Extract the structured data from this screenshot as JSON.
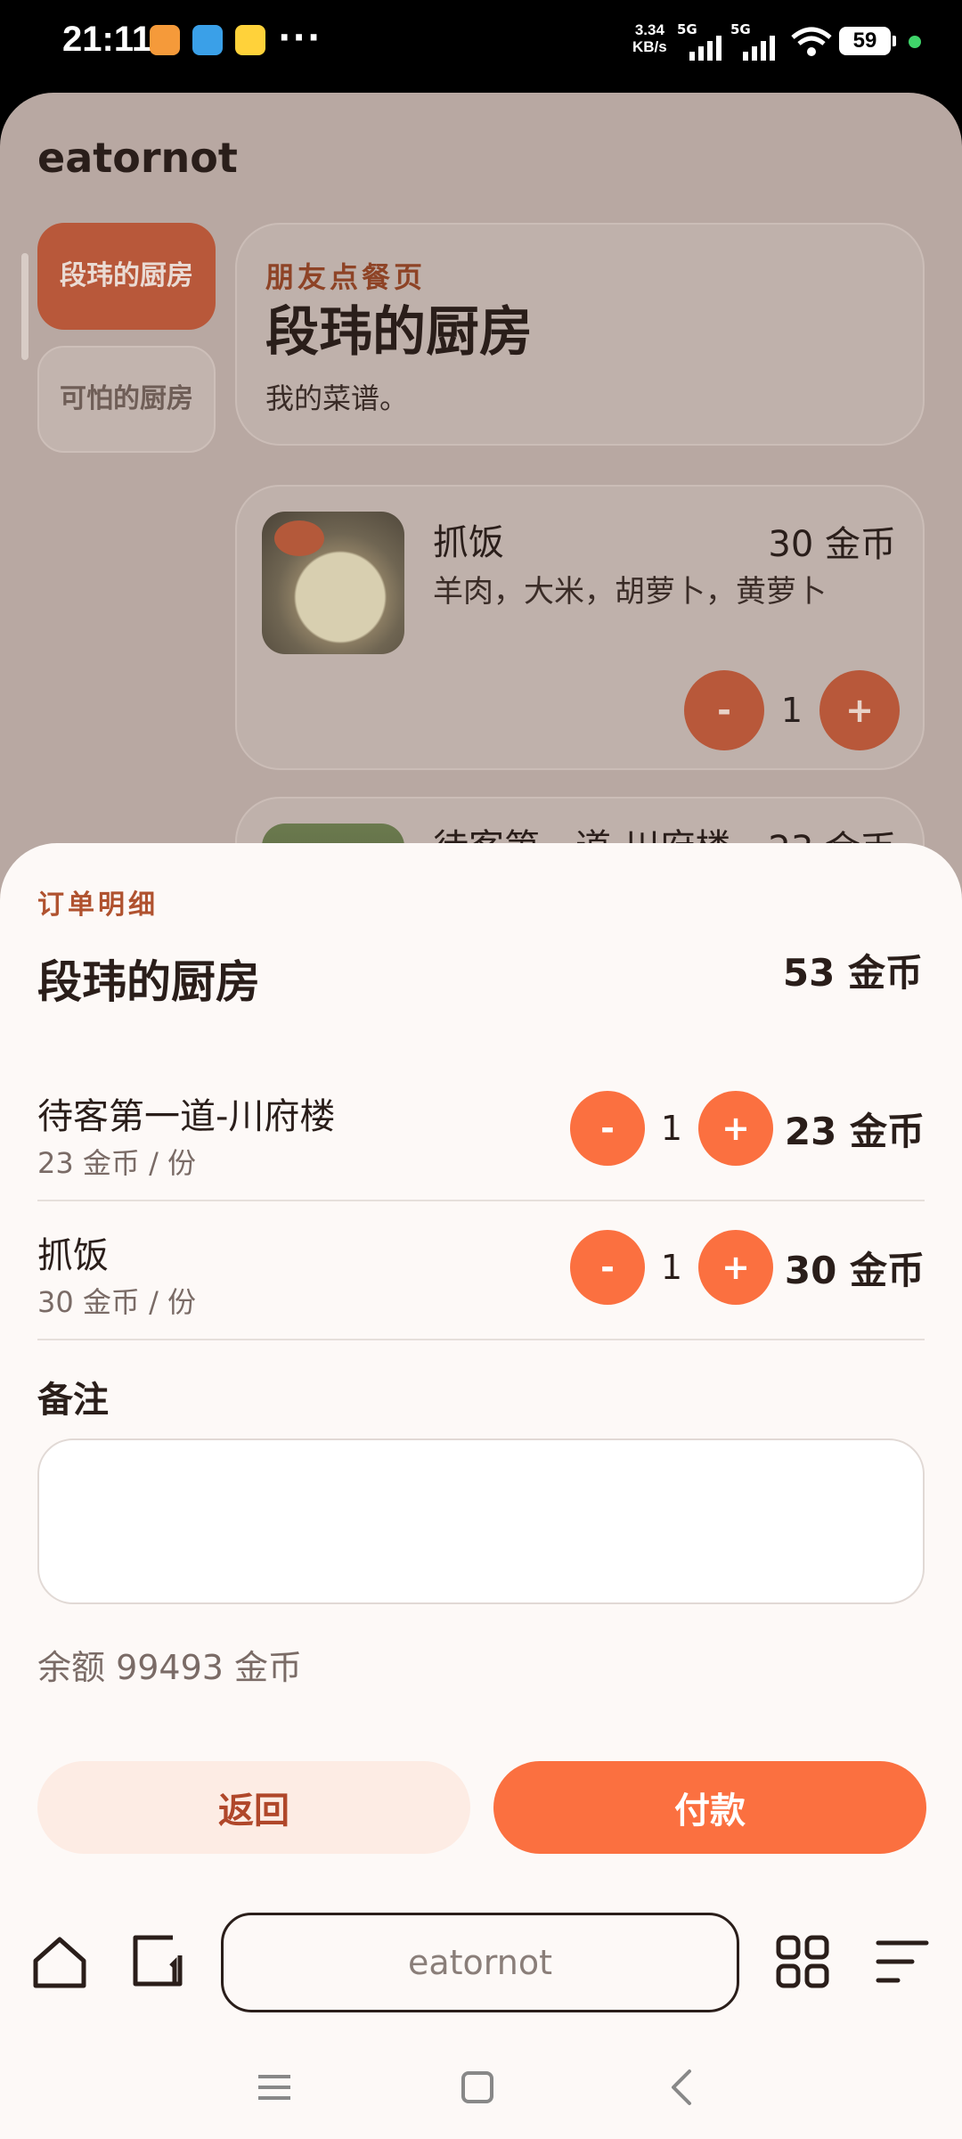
{
  "status_bar": {
    "time": "21:11",
    "net_speed_line1": "3.34",
    "net_speed_line2": "KB/s",
    "signal1_label": "5G",
    "signal2_label": "5G",
    "battery": "59",
    "more": "···"
  },
  "app": {
    "title": "eatornot",
    "kitchens": [
      "段玮的厨房",
      "可怕的厨房"
    ],
    "hero": {
      "caption": "朋友点餐页",
      "title": "段玮的厨房",
      "desc": "我的菜谱。"
    },
    "dishes": [
      {
        "name": "抓饭",
        "price": "30 金币",
        "ingredients": "羊肉，大米，胡萝卜，黄萝卜",
        "qty": "1"
      },
      {
        "name": "待客第一道-川府楼",
        "price": "23 金币"
      }
    ]
  },
  "sheet": {
    "caption": "订单明细",
    "kitchen": "段玮的厨房",
    "total": "53 金币",
    "items": [
      {
        "name": "待客第一道-川府楼",
        "unit": "23 金币 / 份",
        "qty": "1",
        "price": "23 金币"
      },
      {
        "name": "抓饭",
        "unit": "30 金币 / 份",
        "qty": "1",
        "price": "30 金币"
      }
    ],
    "note_label": "备注",
    "note_value": "",
    "balance": "余额 99493 金币",
    "back_label": "返回",
    "pay_label": "付款",
    "minus": "-",
    "plus": "+"
  },
  "browser": {
    "url": "eatornot"
  },
  "colors": {
    "accent": "#fb7040",
    "accent_dim": "#b8583a",
    "sheet_bg": "#fdf9f7",
    "caption": "#b0522f"
  }
}
